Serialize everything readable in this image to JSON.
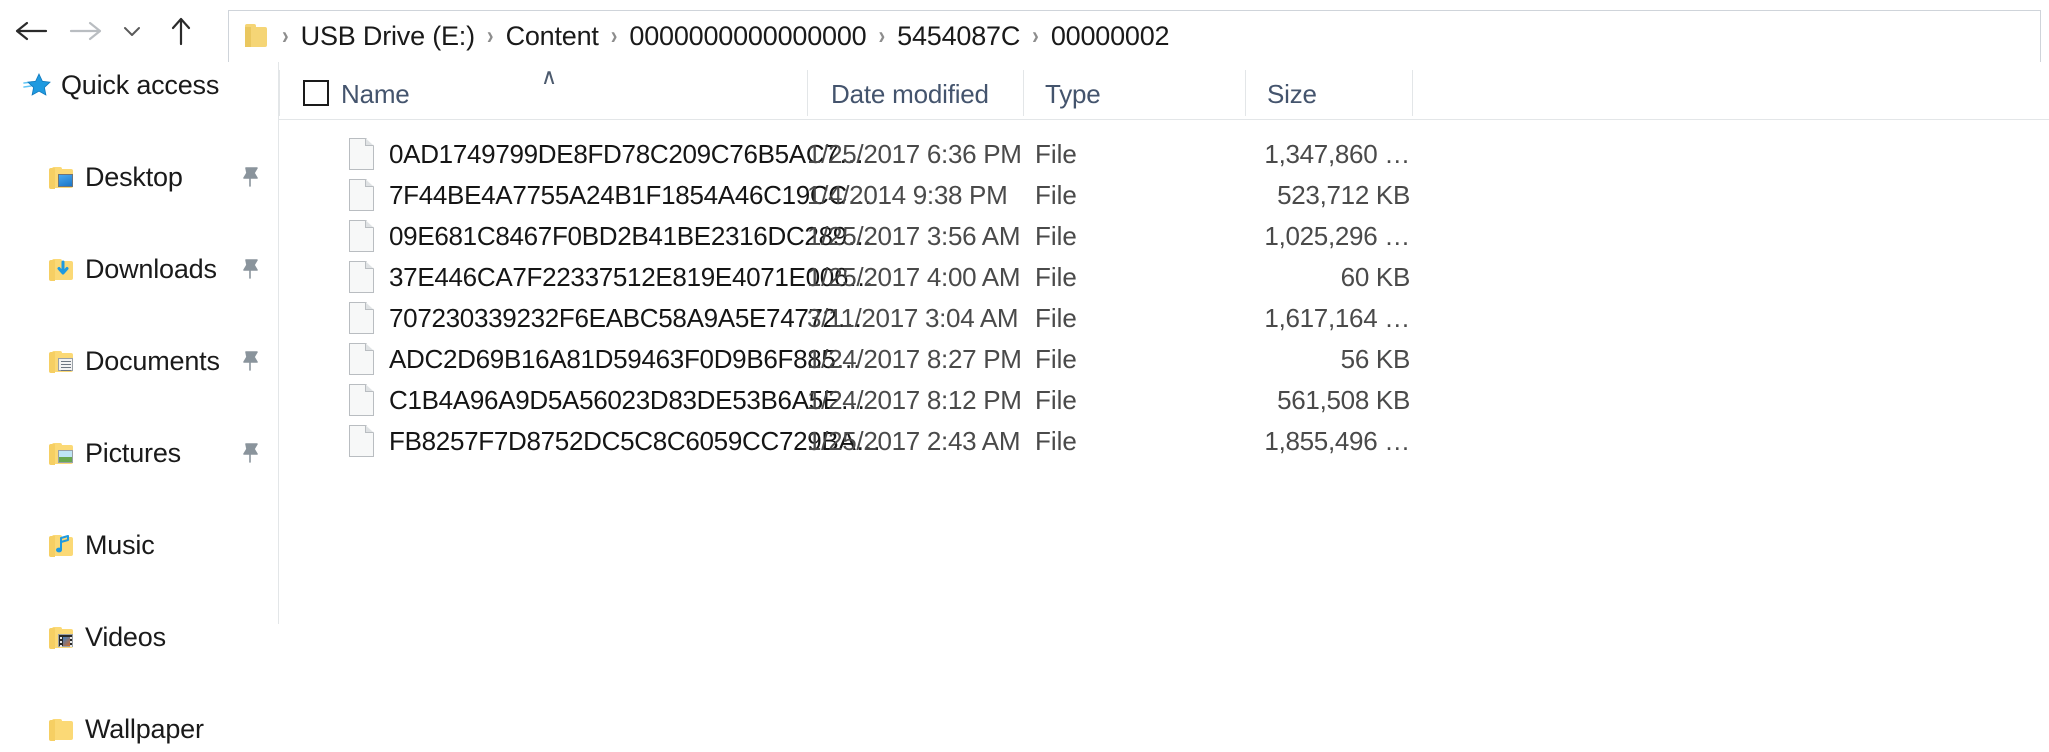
{
  "nav": {
    "back_icon": "arrow-left-icon",
    "forward_icon": "arrow-right-icon",
    "recent_icon": "chevron-down-icon",
    "up_icon": "arrow-up-icon",
    "folder_icon": "folder-icon",
    "separator": "›",
    "breadcrumbs": [
      "USB Drive (E:)",
      "Content",
      "0000000000000000",
      "5454087C",
      "00000002"
    ]
  },
  "sidebar": {
    "items": [
      {
        "label": "Quick access",
        "icon": "star-icon",
        "pinned": false
      },
      {
        "label": "Desktop",
        "icon": "folder-desktop-icon",
        "pinned": true
      },
      {
        "label": "Downloads",
        "icon": "folder-downloads-icon",
        "pinned": true
      },
      {
        "label": "Documents",
        "icon": "folder-documents-icon",
        "pinned": true
      },
      {
        "label": "Pictures",
        "icon": "folder-pictures-icon",
        "pinned": true
      },
      {
        "label": "Music",
        "icon": "folder-music-icon",
        "pinned": false
      },
      {
        "label": "Videos",
        "icon": "folder-videos-icon",
        "pinned": false
      },
      {
        "label": "Wallpaper",
        "icon": "folder-icon",
        "pinned": false
      }
    ],
    "pin_icon": "pin-icon"
  },
  "list": {
    "sort_indicator": "∧",
    "headers": {
      "name": "Name",
      "date_modified": "Date modified",
      "type": "Type",
      "size": "Size"
    },
    "select_all_checkbox": "select-all-checkbox",
    "rows": [
      {
        "name": "0AD1749799DE8FD78C209C76B5AC7…",
        "date": "1/25/2017 6:36 PM",
        "type": "File",
        "size": "1,347,860 …"
      },
      {
        "name": "7F44BE4A7755A24B1F1854A46C19CC…",
        "date": "1/4/2014 9:38 PM",
        "type": "File",
        "size": "523,712 KB"
      },
      {
        "name": "09E681C8467F0BD2B41BE2316DC289…",
        "date": "1/25/2017 3:56 AM",
        "type": "File",
        "size": "1,025,296 …"
      },
      {
        "name": "37E446CA7F22337512E819E4071E006…",
        "date": "1/25/2017 4:00 AM",
        "type": "File",
        "size": "60 KB"
      },
      {
        "name": "707230339232F6EABC58A9A5E74772…",
        "date": "3/11/2017 3:04 AM",
        "type": "File",
        "size": "1,617,164 …"
      },
      {
        "name": "ADC2D69B16A81D59463F0D9B6F885…",
        "date": "1/24/2017 8:27 PM",
        "type": "File",
        "size": "56 KB"
      },
      {
        "name": "C1B4A96A9D5A56023D83DE53B6A5E…",
        "date": "1/24/2017 8:12 PM",
        "type": "File",
        "size": "561,508 KB"
      },
      {
        "name": "FB8257F7D8752DC5C8C6059CC729BA…",
        "date": "1/25/2017 2:43 AM",
        "type": "File",
        "size": "1,855,496 …"
      }
    ]
  },
  "colors": {
    "header_text": "#44546d",
    "folder_yellow": "#fbd976",
    "accent_blue": "#1b77c8"
  }
}
